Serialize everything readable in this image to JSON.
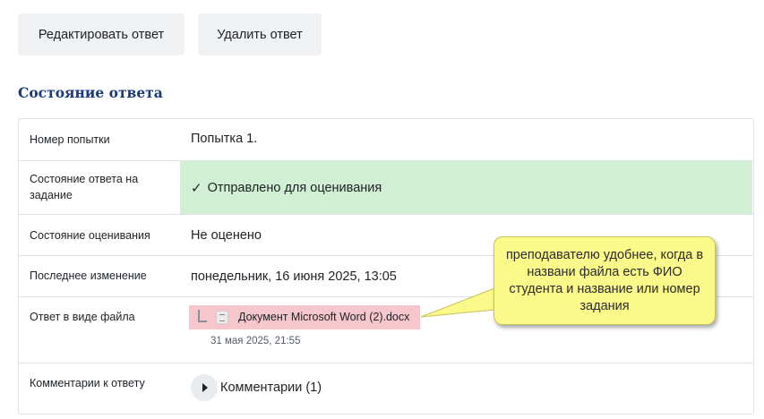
{
  "actions": {
    "edit_label": "Редактировать ответ",
    "delete_label": "Удалить ответ"
  },
  "section_title": "Состояние ответа",
  "rows": {
    "attempt": {
      "label": "Номер попытки",
      "value": "Попытка 1."
    },
    "submission_status": {
      "label": "Состояние ответа на задание",
      "value": "Отправлено для оценивания",
      "icon": "check-icon"
    },
    "grading_status": {
      "label": "Состояние оценивания",
      "value": "Не оценено"
    },
    "last_modified": {
      "label": "Последнее изменение",
      "value": "понедельник, 16 июня 2025, 13:05"
    },
    "file_submission": {
      "label": "Ответ в виде файла",
      "file_name": "Документ Microsoft Word (2).docx",
      "file_date": "31 мая 2025, 21:55"
    },
    "comments": {
      "label": "Комментарии к ответу",
      "toggle_label": "Комментарии (1)"
    }
  },
  "callout": {
    "text": "преподавателю удобнее, когда в названи файла есть ФИО студента и название или номер задания"
  },
  "colors": {
    "success_bg": "#d1efd3",
    "highlight_bg": "#f5c6cc",
    "callout_bg": "#fbf98a",
    "title_color": "#1b3a7a"
  }
}
